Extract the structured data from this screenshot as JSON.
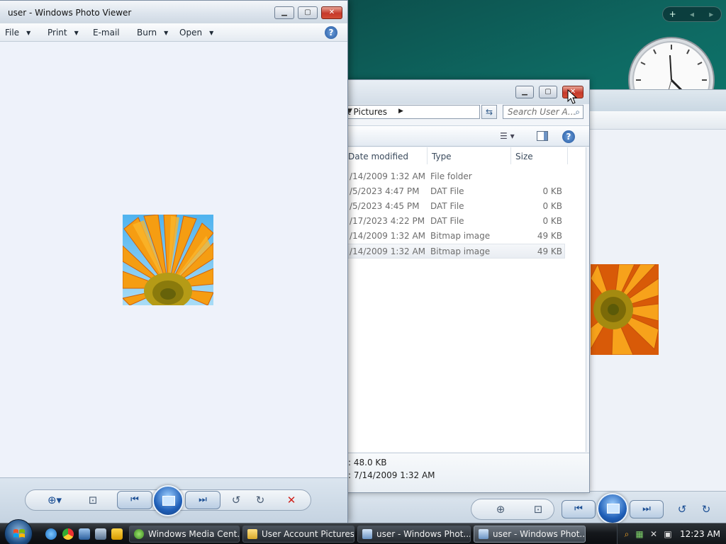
{
  "gadgets": {
    "add_label": "+",
    "prev_label": "◂",
    "next_label": "▸"
  },
  "photo_viewer": {
    "title": "user - Windows Photo Viewer",
    "menu": [
      {
        "label": "File"
      },
      {
        "label": "Print"
      },
      {
        "label": "E-mail"
      },
      {
        "label": "Burn"
      },
      {
        "label": "Open"
      }
    ],
    "help_label": "?",
    "controls": {
      "zoom_icon": "zoom-icon",
      "fit_icon": "actual-size-icon",
      "prev_icon": "previous-icon",
      "slideshow_icon": "slideshow-icon",
      "next_icon": "next-icon",
      "rotate_ccw_icon": "rotate-counterclockwise-icon",
      "rotate_cw_icon": "rotate-clockwise-icon",
      "delete_icon": "delete-icon"
    }
  },
  "explorer": {
    "address": "t Pictures",
    "search_placeholder": "Search User A...",
    "columns": {
      "date": "Date modified",
      "type": "Type",
      "size": "Size"
    },
    "rows": [
      {
        "date": "/14/2009 1:32 AM",
        "type": "File folder",
        "size": ""
      },
      {
        "date": "/5/2023 4:47 PM",
        "type": "DAT File",
        "size": "0 KB"
      },
      {
        "date": "/5/2023 4:45 PM",
        "type": "DAT File",
        "size": "0 KB"
      },
      {
        "date": "/17/2023 4:22 PM",
        "type": "DAT File",
        "size": "0 KB"
      },
      {
        "date": "/14/2009 1:32 AM",
        "type": "Bitmap image",
        "size": "49 KB"
      },
      {
        "date": "/14/2009 1:32 AM",
        "type": "Bitmap image",
        "size": "49 KB"
      }
    ],
    "details": {
      "size_line": ": 48.0 KB",
      "date_line": ": 7/14/2009 1:32 AM"
    }
  },
  "taskbar": {
    "tasks": [
      {
        "label": "Windows Media Cent..."
      },
      {
        "label": "User Account Pictures"
      },
      {
        "label": "user - Windows Phot..."
      },
      {
        "label": "user - Windows Phot..."
      }
    ],
    "clock": "12:23 AM"
  },
  "colors": {
    "accent": "#1f5fb8",
    "close": "#c6392a",
    "delete": "#d0201a"
  }
}
